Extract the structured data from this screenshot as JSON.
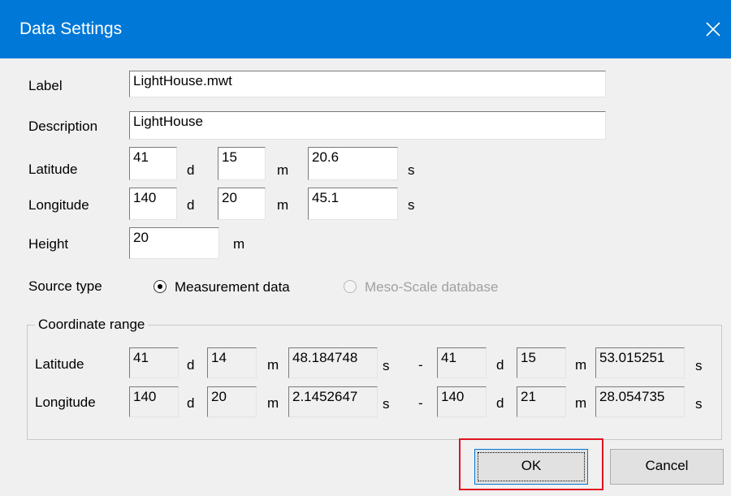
{
  "window": {
    "title": "Data Settings",
    "close_icon": "close-icon"
  },
  "form": {
    "label": {
      "caption": "Label",
      "value": "LightHouse.mwt"
    },
    "description": {
      "caption": "Description",
      "value": "LightHouse"
    },
    "latitude": {
      "caption": "Latitude",
      "deg": "41",
      "min": "15",
      "sec": "20.6"
    },
    "longitude": {
      "caption": "Longitude",
      "deg": "140",
      "min": "20",
      "sec": "45.1"
    },
    "height": {
      "caption": "Height",
      "value": "20",
      "unit": "m"
    },
    "units": {
      "d": "d",
      "m": "m",
      "s": "s"
    },
    "source_type": {
      "caption": "Source type",
      "options": [
        {
          "label": "Measurement data",
          "selected": true,
          "enabled": true
        },
        {
          "label": "Meso-Scale database",
          "selected": false,
          "enabled": false
        }
      ]
    }
  },
  "coord_range": {
    "title": "Coordinate range",
    "dash": "-",
    "latitude": {
      "caption": "Latitude",
      "from": {
        "deg": "41",
        "min": "14",
        "sec": "48.184748"
      },
      "to": {
        "deg": "41",
        "min": "15",
        "sec": "53.015251"
      }
    },
    "longitude": {
      "caption": "Longitude",
      "from": {
        "deg": "140",
        "min": "20",
        "sec": "2.1452647"
      },
      "to": {
        "deg": "140",
        "min": "21",
        "sec": "28.054735"
      }
    }
  },
  "buttons": {
    "ok": "OK",
    "cancel": "Cancel"
  },
  "colors": {
    "titlebar": "#0078d7",
    "highlight": "#e0141e",
    "background": "#f0f0f0"
  }
}
